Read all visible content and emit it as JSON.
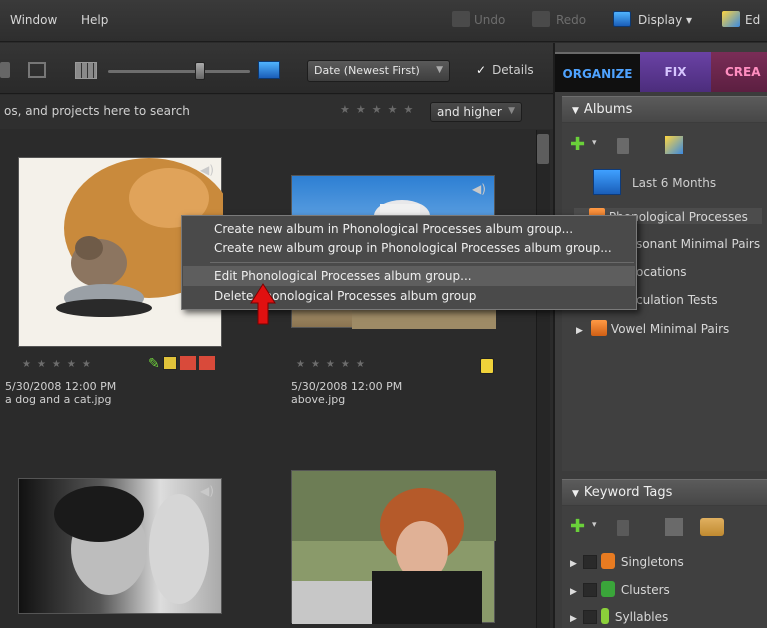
{
  "menubar": {
    "items": [
      "Window",
      "Help"
    ],
    "undo": "Undo",
    "redo": "Redo",
    "display": "Display",
    "edit_partial": "Ed"
  },
  "toolbar": {
    "sort": "Date (Newest First)",
    "details": "Details"
  },
  "search": {
    "hint": "os, and projects here to search",
    "rating_filter": "and higher"
  },
  "tabs": {
    "organize": "ORGANIZE",
    "fix": "FIX",
    "create": "CREA"
  },
  "albums": {
    "header": "Albums",
    "items": [
      {
        "label": "Last 6 Months"
      },
      {
        "label": "Phonological Processes"
      },
      {
        "label": "sonant Minimal Pairs"
      },
      {
        "label": "ocations"
      },
      {
        "label": "culation Tests"
      },
      {
        "label": "Vowel Minimal Pairs"
      }
    ]
  },
  "keywords": {
    "header": "Keyword Tags",
    "items": [
      {
        "label": "Singletons",
        "color": "#e87b21"
      },
      {
        "label": "Clusters",
        "color": "#3aa53a"
      },
      {
        "label": "Syllables",
        "color": "#8bd03a"
      }
    ]
  },
  "context_menu": {
    "items": [
      "Create new album in Phonological Processes album group...",
      "Create new album group in Phonological Processes album group...",
      "Edit Phonological Processes album group...",
      "Delete Phonological Processes album group"
    ]
  },
  "photos": [
    {
      "date": "5/30/2008 12:00 PM",
      "name": "a dog and a cat.jpg"
    },
    {
      "date": "5/30/2008 12:00 PM",
      "name": "above.jpg"
    }
  ],
  "colors": {
    "organize_tab": "#4fa3ff",
    "fix_tab": "#6a42a5",
    "create_tab": "#7a2d57",
    "arrow": "#e01010"
  }
}
